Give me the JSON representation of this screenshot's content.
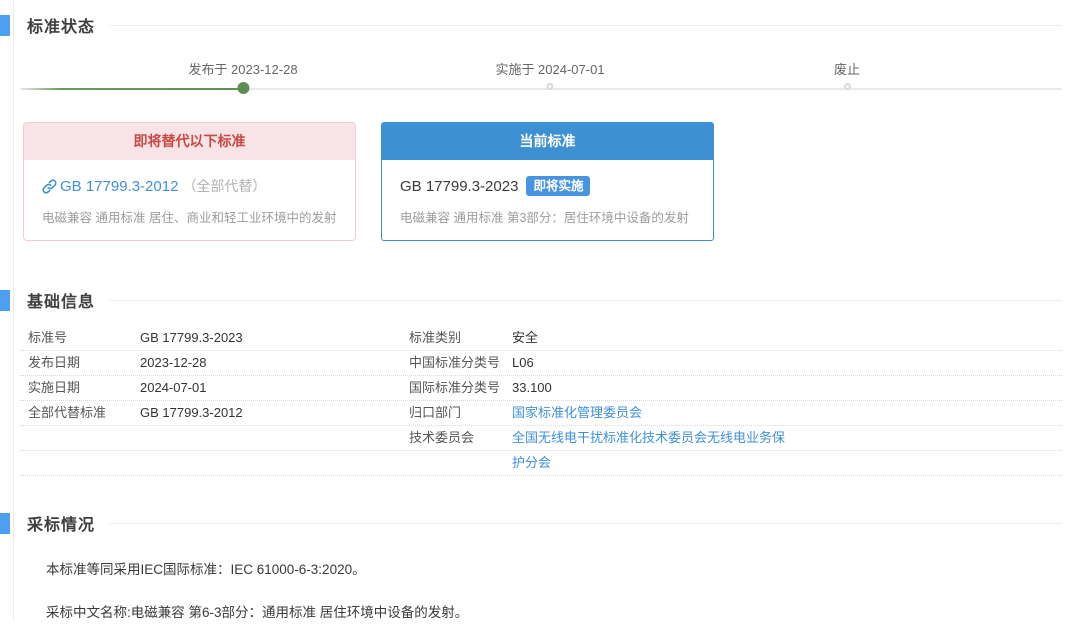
{
  "colors": {
    "section_bar_blue": "#4d9ff0",
    "card_header_blue": "#3d90d2",
    "badge_blue": "#4795e0",
    "replace_header_bg": "#f8e4e6",
    "replace_header_text": "#c94a44",
    "timeline_green": "#5d8f53",
    "link_blue": "#3f90d9"
  },
  "sections": {
    "status": {
      "title": "标准状态"
    },
    "basic": {
      "title": "基础信息"
    },
    "adoption": {
      "title": "采标情况"
    }
  },
  "timeline": {
    "nodes": [
      {
        "label": "发布于 2023-12-28",
        "state": "done"
      },
      {
        "label": "实施于 2024-07-01",
        "state": "todo"
      },
      {
        "label": "废止",
        "state": "todo"
      }
    ]
  },
  "cards": {
    "replace": {
      "header": "即将替代以下标准",
      "link_icon": "chain-link-icon",
      "link_text": "GB 17799.3-2012",
      "note": "（全部代替）",
      "desc": "电磁兼容 通用标准 居住、商业和轻工业环境中的发射"
    },
    "current": {
      "header": "当前标准",
      "code": "GB 17799.3-2023",
      "badge": "即将实施",
      "desc": "电磁兼容 通用标准 第3部分：居住环境中设备的发射"
    }
  },
  "basic_info": {
    "rows": [
      {
        "l1": "标准号",
        "v1": "GB 17799.3-2023",
        "l2": "标准类别",
        "v2": "安全"
      },
      {
        "l1": "发布日期",
        "v1": "2023-12-28",
        "l2": "中国标准分类号",
        "v2": "L06"
      },
      {
        "l1": "实施日期",
        "v1": "2024-07-01",
        "l2": "国际标准分类号",
        "v2": "33.100"
      },
      {
        "l1": "全部代替标准",
        "v1": "GB 17799.3-2012",
        "l2": "归口部门",
        "v2": "国家标准化管理委员会"
      },
      {
        "l1": "",
        "v1": "",
        "l2": "技术委员会",
        "v2": "全国无线电干扰标准化技术委员会无线电业务保"
      },
      {
        "l1": "",
        "v1": "",
        "l2": "",
        "v2": "护分会"
      }
    ]
  },
  "adoption": {
    "line1": "本标准等同采用IEC国际标准：IEC 61000-6-3:2020。",
    "line2": "采标中文名称:电磁兼容 第6-3部分：通用标准 居住环境中设备的发射。"
  }
}
